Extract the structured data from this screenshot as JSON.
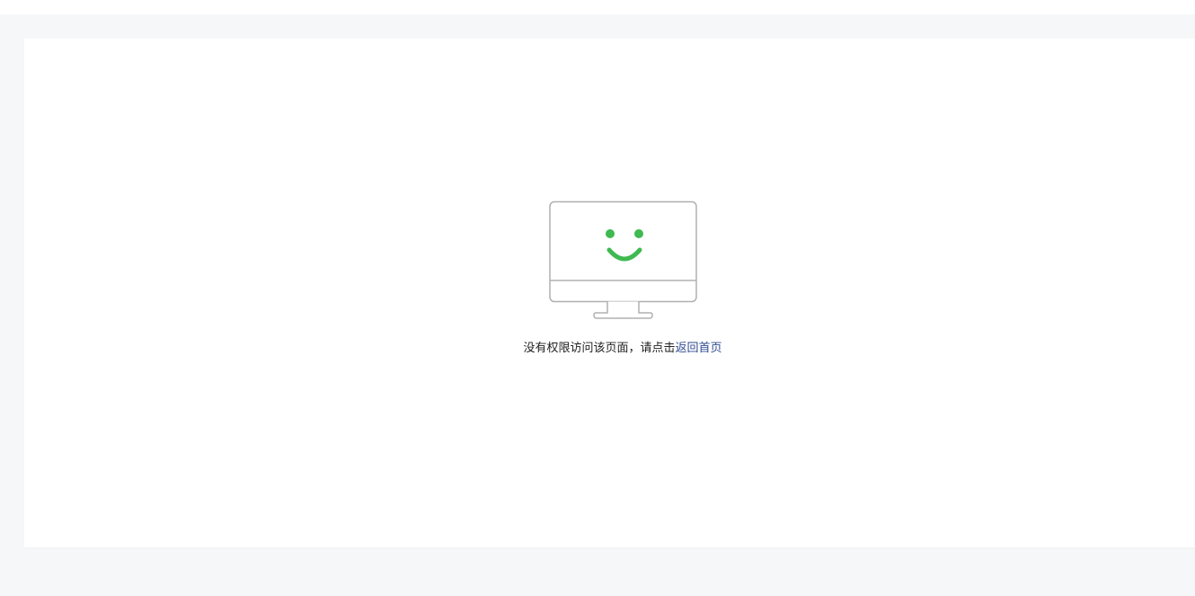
{
  "message": {
    "prefix": "没有权限访问该页面，请点击",
    "link_label": "返回首页"
  },
  "illustration": {
    "icon": "monitor-smiley-icon",
    "face_color": "#3fb950",
    "frame_color": "#b0b0b0"
  },
  "colors": {
    "page_background": "#f6f7f9",
    "panel_background": "#ffffff",
    "link": "#2f4a8f"
  }
}
